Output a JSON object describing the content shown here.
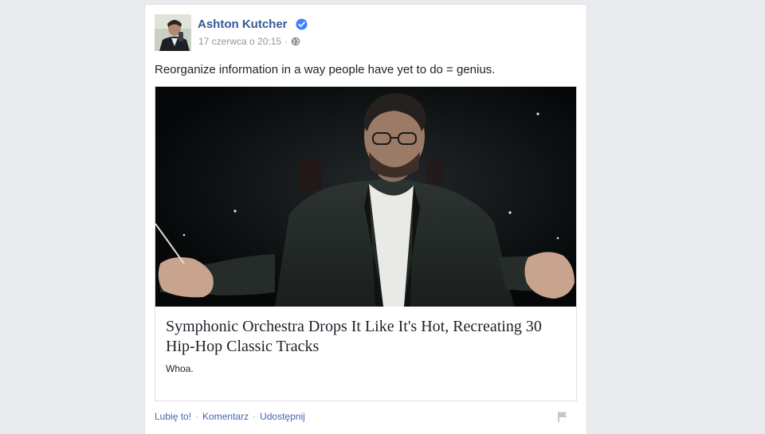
{
  "post": {
    "author": "Ashton Kutcher",
    "timestamp": "17 czerwca o 20:15",
    "separator": "·",
    "text": "Reorganize information in a way people have yet to do = genius.",
    "link": {
      "title": "Symphonic Orchestra Drops It Like It's Hot, Recreating 30 Hip-Hop Classic Tracks",
      "description": "Whoa."
    },
    "actions": {
      "like": "Lubię to!",
      "comment": "Komentarz",
      "share": "Udostępnij",
      "separator": "·"
    },
    "icons": {
      "verified": "verified-badge-icon",
      "audience": "globe-icon",
      "report": "flag-icon"
    }
  },
  "colors": {
    "author_link": "#365899",
    "verified": "#4080ff",
    "meta_text": "#90949c",
    "action_link": "#4267b2",
    "page_background": "#e9ebee"
  }
}
